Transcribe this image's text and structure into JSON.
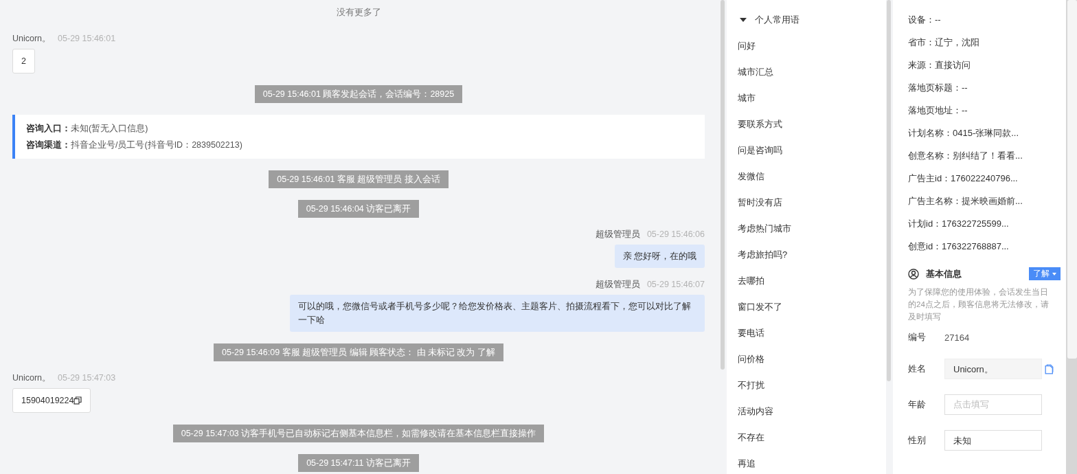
{
  "chat": {
    "load_more": "没有更多了",
    "messages": [
      {
        "kind": "visitor",
        "name": "Unicorn。",
        "time": "05-29 15:46:01",
        "text": "2",
        "copyable": false
      },
      {
        "kind": "system",
        "text": "05-29 15:46:01 顾客发起会话，会话编号：28925"
      },
      {
        "kind": "entry",
        "fields": [
          {
            "label": "咨询入口：",
            "value": "未知(暂无入口信息)"
          },
          {
            "label": "咨询渠道：",
            "value": "抖音企业号/员工号(抖音号ID：2839502213)"
          }
        ]
      },
      {
        "kind": "system",
        "text": "05-29 15:46:01 客服 超级管理员 接入会话"
      },
      {
        "kind": "system",
        "text": "05-29 15:46:04 访客已离开"
      },
      {
        "kind": "agent",
        "name": "超级管理员",
        "time": "05-29 15:46:06",
        "text": "亲 您好呀，在的哦"
      },
      {
        "kind": "agent",
        "name": "超级管理员",
        "time": "05-29 15:46:07",
        "text": "可以的哦，您微信号或者手机号多少呢？给您发价格表、主题客片、拍摄流程看下，您可以对比了解一下哈"
      },
      {
        "kind": "system",
        "text": "05-29 15:46:09 客服 超级管理员 编辑 顾客状态： 由 未标记 改为 了解"
      },
      {
        "kind": "visitor",
        "name": "Unicorn。",
        "time": "05-29 15:47:03",
        "text": "15904019224",
        "copyable": true
      },
      {
        "kind": "system",
        "text": "05-29 15:47:03 访客手机号已自动标记右侧基本信息栏，如需修改请在基本信息栏直接操作"
      },
      {
        "kind": "system",
        "text": "05-29 15:47:11 访客已离开"
      }
    ]
  },
  "phrases": {
    "group": {
      "title": "个人常用语",
      "expanded": true
    },
    "items": [
      "问好",
      "城市汇总",
      "城市",
      "要联系方式",
      "问是咨询吗",
      "发微信",
      "暂时没有店",
      "考虑热门城市",
      "考虑旅拍吗?",
      "去哪拍",
      "窗口发不了",
      "要电话",
      "问价格",
      "不打扰",
      "活动内容",
      "不存在",
      "再追"
    ]
  },
  "visitor_info": {
    "details": [
      "设备：--",
      "省市：辽宁，沈阳",
      "来源：直接访问",
      "落地页标题：--",
      "落地页地址：--",
      "计划名称：0415-张琳同款...",
      "创意名称：别纠结了！看看...",
      "广告主id：176022240796...",
      "广告主名称：提米映画婚前...",
      "计划id：176322725599...",
      "创意id：176322768887..."
    ],
    "basic": {
      "title": "基本信息",
      "status": "了解",
      "notice": "为了保障您的使用体验，会话发生当日的24点之后，顾客信息将无法修改，请及时填写",
      "fields": [
        {
          "kind": "text",
          "label": "编号",
          "value": "27164"
        },
        {
          "kind": "readonly",
          "label": "姓名",
          "value": "Unicorn。"
        },
        {
          "kind": "input",
          "label": "年龄",
          "placeholder": "点击填写"
        },
        {
          "kind": "select",
          "label": "性别",
          "value": "未知"
        }
      ]
    }
  }
}
